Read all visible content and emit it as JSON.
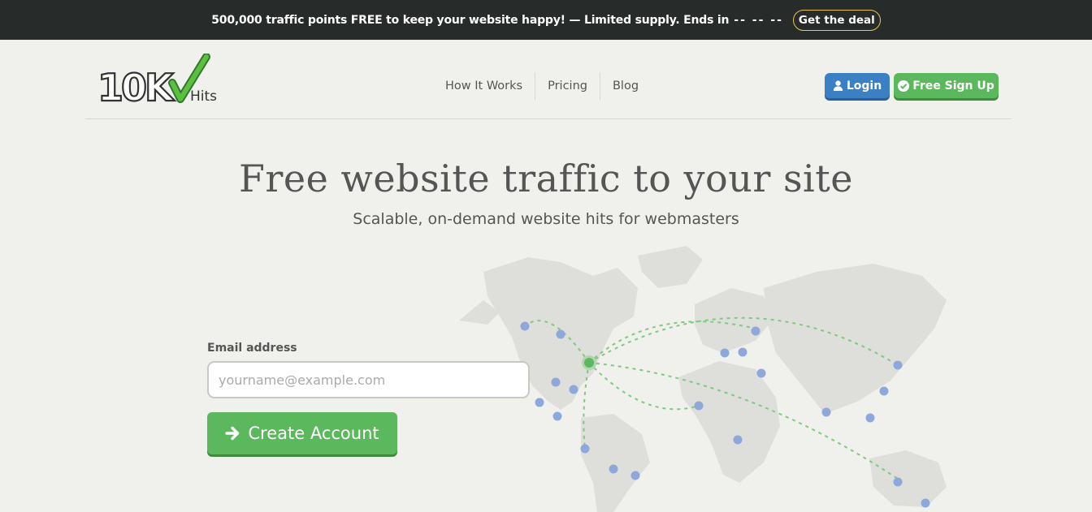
{
  "promo": {
    "text": "500,000 traffic points FREE to keep your website happy! — Limited supply. Ends in",
    "countdown": "-- -- --",
    "deal_label": "Get the deal"
  },
  "logo": {
    "main": "10K",
    "sub": "Hits"
  },
  "nav": {
    "items": [
      "How It Works",
      "Pricing",
      "Blog"
    ]
  },
  "header_buttons": {
    "login": "Login",
    "signup": "Free Sign Up"
  },
  "hero": {
    "title": "Free website traffic to your site",
    "subtitle": "Scalable, on-demand website hits for webmasters"
  },
  "form": {
    "email_label": "Email address",
    "email_placeholder": "yourname@example.com",
    "email_value": "",
    "submit_label": "Create Account"
  },
  "colors": {
    "promo_bg": "#272c2b",
    "deal_border": "#e7c54a",
    "login_blue": "#3c80c4",
    "signup_green": "#5cb85c",
    "map_land": "#dededa",
    "map_dot": "#8ea8dc",
    "route_green": "#7fca7f"
  }
}
